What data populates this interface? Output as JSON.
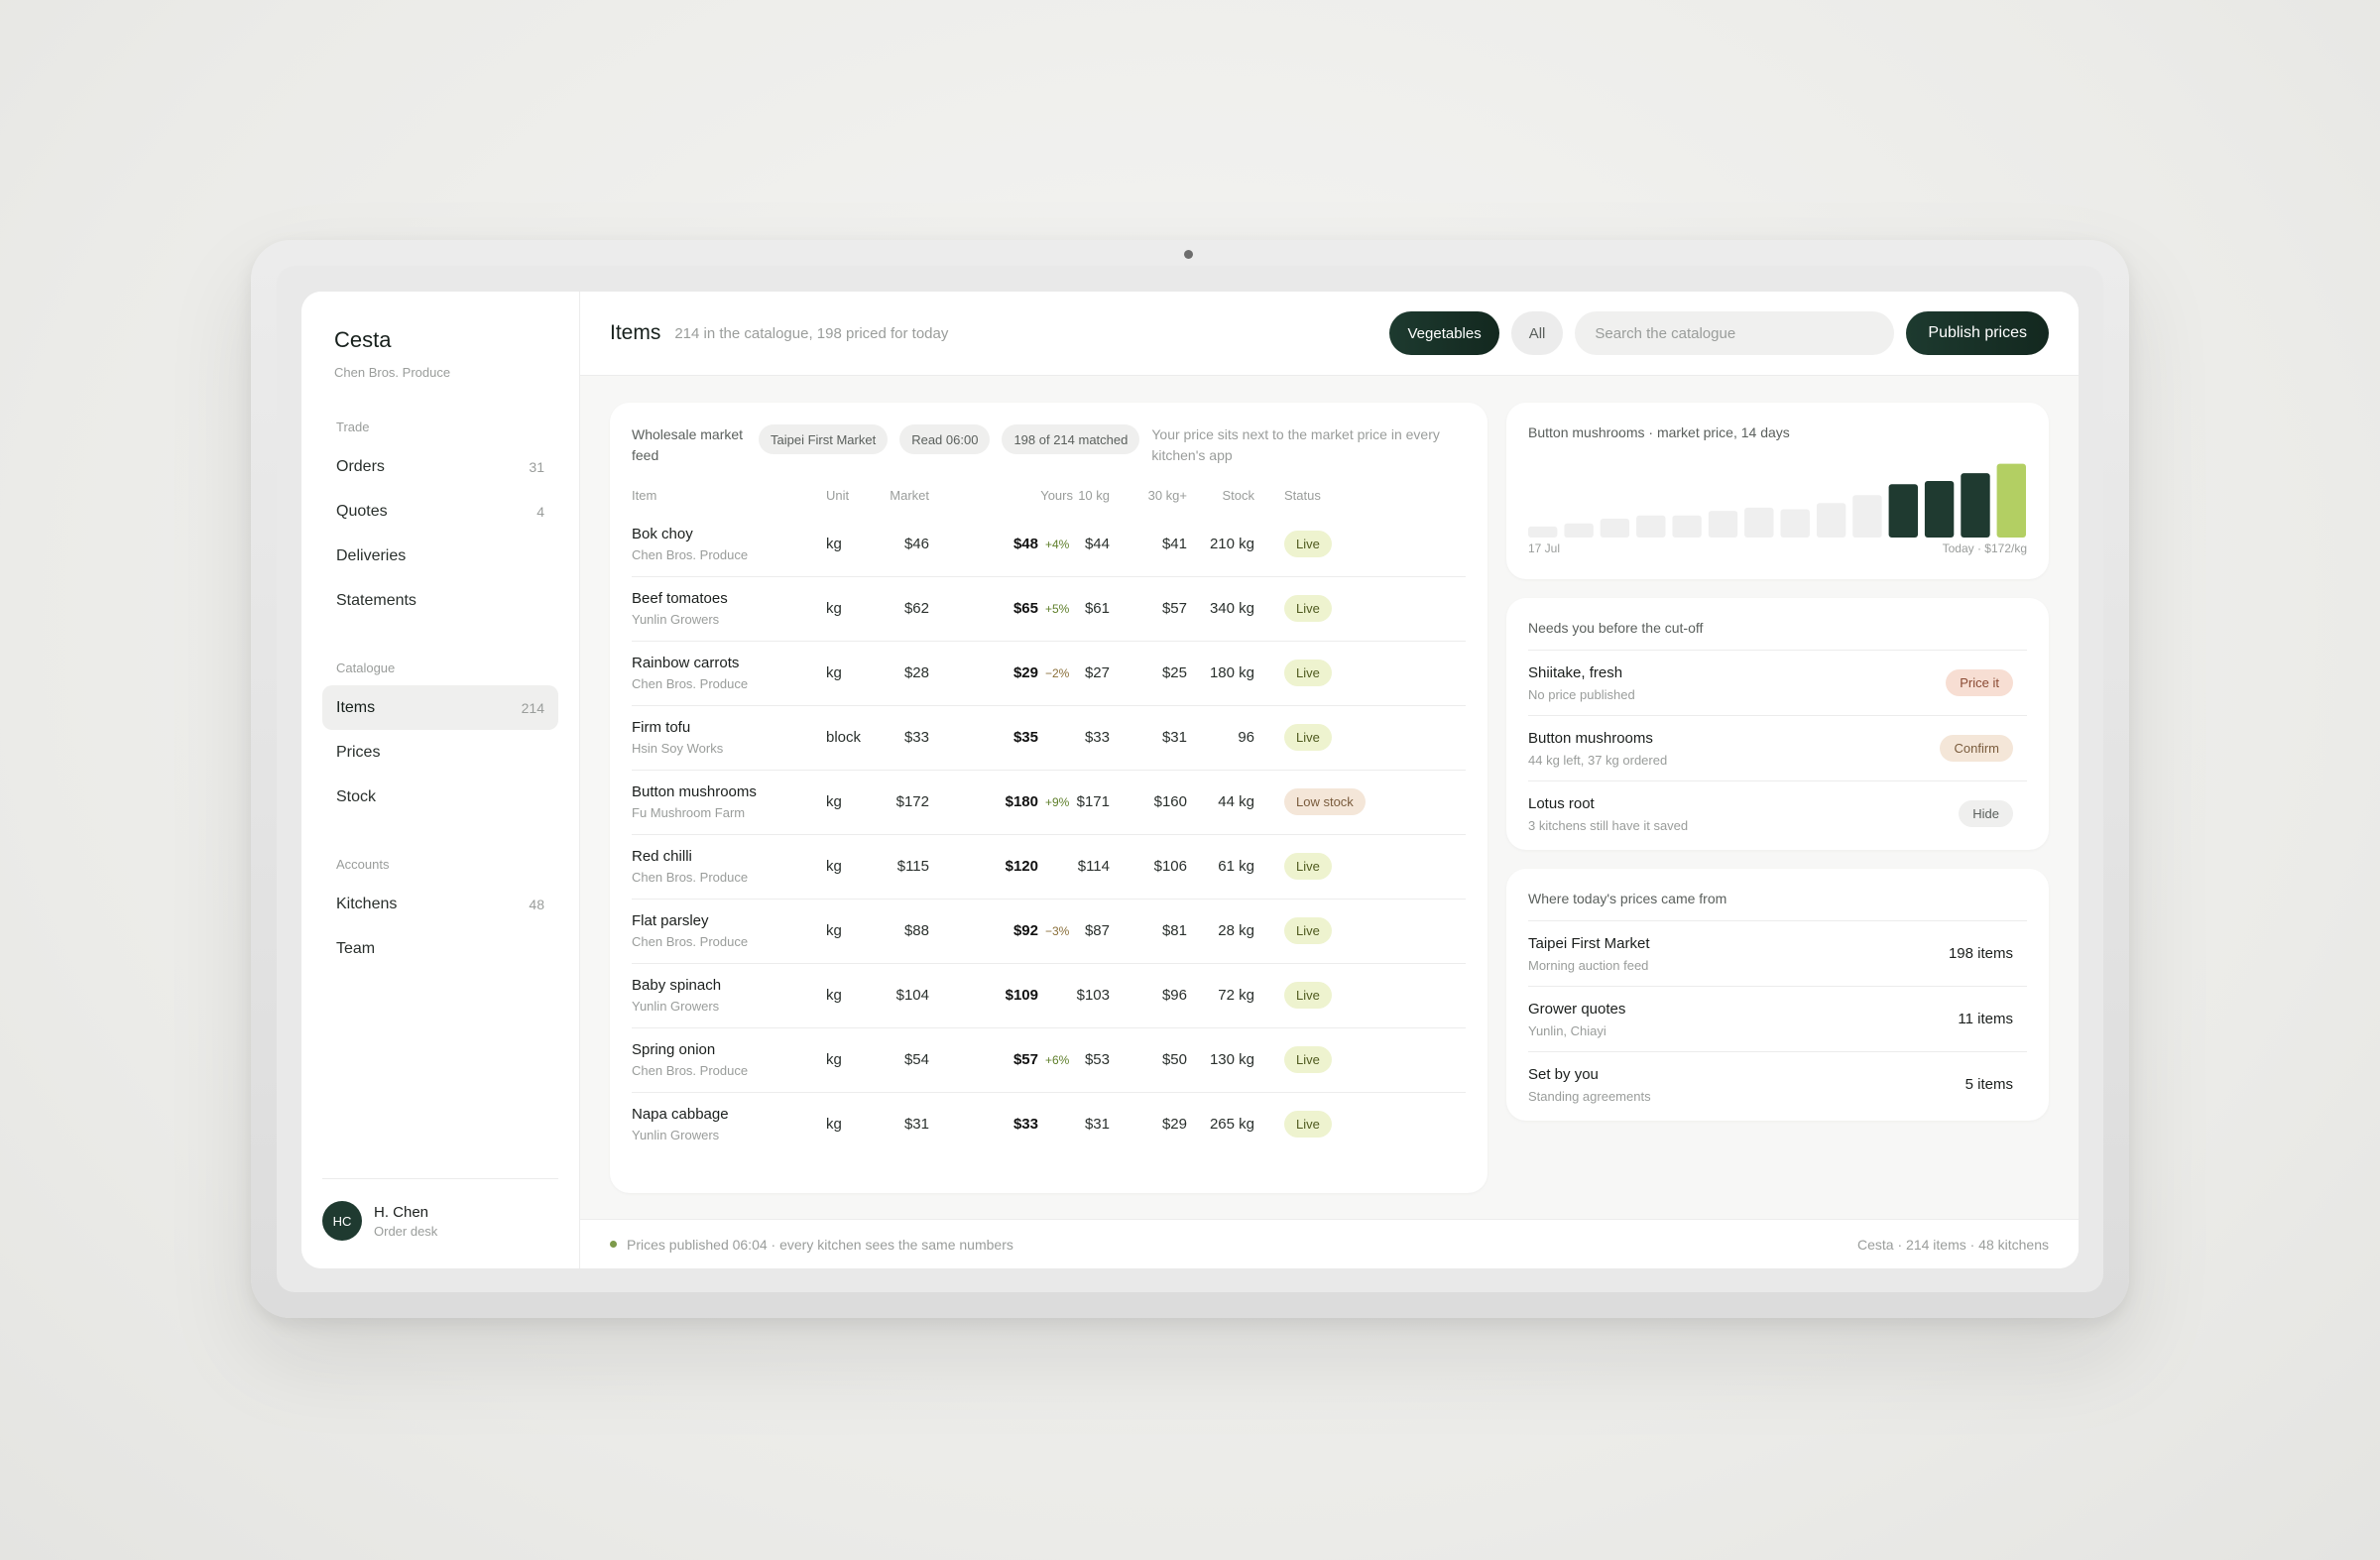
{
  "app": {
    "name": "Cesta",
    "subtitle": "Chen Bros. Produce"
  },
  "sidebar": {
    "groups": [
      {
        "label": "Trade",
        "items": [
          {
            "label": "Orders",
            "count": "31"
          },
          {
            "label": "Quotes",
            "count": "4"
          },
          {
            "label": "Deliveries",
            "count": ""
          },
          {
            "label": "Statements",
            "count": ""
          }
        ]
      },
      {
        "label": "Catalogue",
        "items": [
          {
            "label": "Items",
            "count": "214"
          },
          {
            "label": "Prices",
            "count": ""
          },
          {
            "label": "Stock",
            "count": ""
          }
        ]
      },
      {
        "label": "Accounts",
        "items": [
          {
            "label": "Kitchens",
            "count": "48"
          },
          {
            "label": "Team",
            "count": ""
          }
        ]
      }
    ],
    "profile": {
      "initials": "HC",
      "name": "H. Chen",
      "role": "Order desk"
    }
  },
  "header": {
    "title": "Items",
    "subtitle": "214 in the catalogue, 198 priced for today",
    "filter_active": "Vegetables",
    "filter_all": "All",
    "search_placeholder": "Search the catalogue",
    "publish_label": "Publish prices"
  },
  "feed": {
    "label": "Wholesale market feed",
    "chips": [
      "Taipei First Market",
      "Read 06:00",
      "198 of 214 matched"
    ],
    "note": "Your price sits next to the market price in every kitchen's app"
  },
  "table": {
    "columns": [
      "Item",
      "Unit",
      "Market",
      "Yours",
      "10 kg",
      "30 kg+",
      "Stock",
      "Status"
    ],
    "rows": [
      {
        "name": "Bok choy",
        "supplier": "Chen Bros. Produce",
        "unit": "kg",
        "market": "$46",
        "yours": "$48",
        "delta": "+4%",
        "tier10": "$44",
        "tier30": "$41",
        "stock": "210 kg",
        "status": "Live"
      },
      {
        "name": "Beef tomatoes",
        "supplier": "Yunlin Growers",
        "unit": "kg",
        "market": "$62",
        "yours": "$65",
        "delta": "+5%",
        "tier10": "$61",
        "tier30": "$57",
        "stock": "340 kg",
        "status": "Live"
      },
      {
        "name": "Rainbow carrots",
        "supplier": "Chen Bros. Produce",
        "unit": "kg",
        "market": "$28",
        "yours": "$29",
        "delta": "−2%",
        "tier10": "$27",
        "tier30": "$25",
        "stock": "180 kg",
        "status": "Live"
      },
      {
        "name": "Firm tofu",
        "supplier": "Hsin Soy Works",
        "unit": "block",
        "market": "$33",
        "yours": "$35",
        "delta": "",
        "tier10": "$33",
        "tier30": "$31",
        "stock": "96",
        "status": "Live"
      },
      {
        "name": "Button mushrooms",
        "supplier": "Fu Mushroom Farm",
        "unit": "kg",
        "market": "$172",
        "yours": "$180",
        "delta": "+9%",
        "tier10": "$171",
        "tier30": "$160",
        "stock": "44 kg",
        "status": "Low stock"
      },
      {
        "name": "Red chilli",
        "supplier": "Chen Bros. Produce",
        "unit": "kg",
        "market": "$115",
        "yours": "$120",
        "delta": "",
        "tier10": "$114",
        "tier30": "$106",
        "stock": "61 kg",
        "status": "Live"
      },
      {
        "name": "Flat parsley",
        "supplier": "Chen Bros. Produce",
        "unit": "kg",
        "market": "$88",
        "yours": "$92",
        "delta": "−3%",
        "tier10": "$87",
        "tier30": "$81",
        "stock": "28 kg",
        "status": "Live"
      },
      {
        "name": "Baby spinach",
        "supplier": "Yunlin Growers",
        "unit": "kg",
        "market": "$104",
        "yours": "$109",
        "delta": "",
        "tier10": "$103",
        "tier30": "$96",
        "stock": "72 kg",
        "status": "Live"
      },
      {
        "name": "Spring onion",
        "supplier": "Chen Bros. Produce",
        "unit": "kg",
        "market": "$54",
        "yours": "$57",
        "delta": "+6%",
        "tier10": "$53",
        "tier30": "$50",
        "stock": "130 kg",
        "status": "Live"
      },
      {
        "name": "Napa cabbage",
        "supplier": "Yunlin Growers",
        "unit": "kg",
        "market": "$31",
        "yours": "$33",
        "delta": "",
        "tier10": "$31",
        "tier30": "$29",
        "stock": "265 kg",
        "status": "Live"
      }
    ]
  },
  "market_chart": {
    "title": "Button mushrooms · market price, 14 days",
    "start_label": "17 Jul",
    "end_label": "Today · $172/kg",
    "values": [
      132,
      134,
      137,
      139,
      139,
      142,
      144,
      143,
      147,
      152,
      159,
      161,
      166,
      172
    ],
    "colors": {
      "muted": "#efefef",
      "recent": "#1f3a30",
      "today": "#b3cf63"
    }
  },
  "cutoff": {
    "title": "Needs you before the cut-off",
    "items": [
      {
        "title": "Shiitake, fresh",
        "sub": "No price published",
        "action": "Price it",
        "kind": "price"
      },
      {
        "title": "Button mushrooms",
        "sub": "44 kg left, 37 kg ordered",
        "action": "Confirm",
        "kind": "confirm"
      },
      {
        "title": "Lotus root",
        "sub": "3 kitchens still have it saved",
        "action": "Hide",
        "kind": "hide"
      }
    ]
  },
  "sources": {
    "title": "Where today's prices came from",
    "items": [
      {
        "title": "Taipei First Market",
        "sub": "Morning auction feed",
        "count": "198 items"
      },
      {
        "title": "Grower quotes",
        "sub": "Yunlin, Chiayi",
        "count": "11 items"
      },
      {
        "title": "Set by you",
        "sub": "Standing agreements",
        "count": "5 items"
      }
    ]
  },
  "footer": {
    "left": "Prices published 06:04 · every kitchen sees the same numbers",
    "right": "Cesta · 214 items · 48 kitchens"
  },
  "colors": {
    "accent": "#1f3a30",
    "live": "#eef3cf",
    "low_stock": "#f4e6d8"
  }
}
